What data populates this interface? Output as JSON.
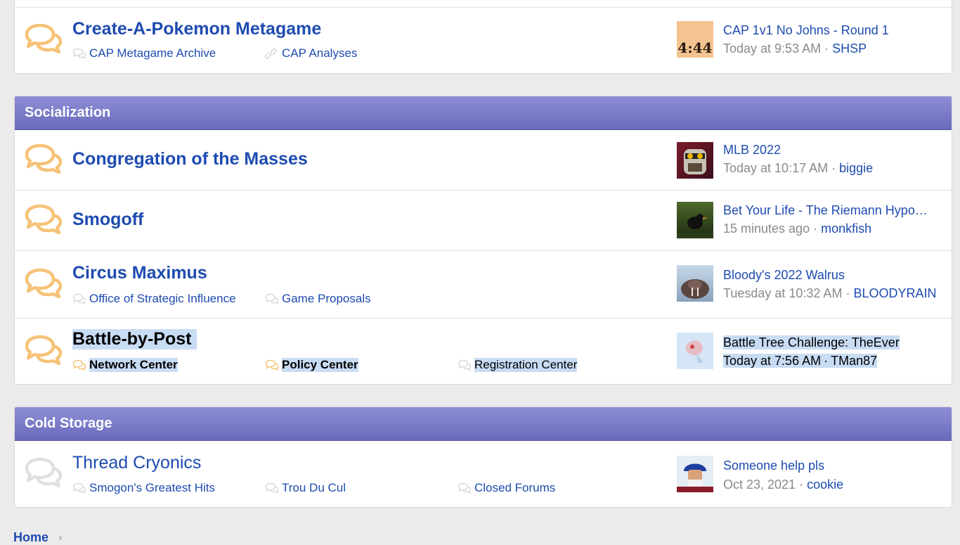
{
  "colors": {
    "link": "#1e4bb0",
    "icon_unread": "#f6c277",
    "icon_read": "#d8d8d8",
    "header_gradient_top": "#8e8ed6",
    "header_gradient_bottom": "#6a6abc",
    "selection": "#c8dcf4"
  },
  "cap": {
    "title": "Create-A-Pokemon Metagame",
    "subforums": [
      "CAP Metagame Archive",
      "CAP Analyses"
    ],
    "last_post": {
      "title": "CAP 1v1 No Johns - Round 1",
      "time": "Today at 9:53 AM",
      "user": "SHSP",
      "avatar_text": "4:44"
    }
  },
  "socialization": {
    "header": "Socialization",
    "forums": [
      {
        "title": "Congregation of the Masses",
        "last_post": {
          "title": "MLB 2022",
          "time": "Today at 10:17 AM",
          "user": "biggie"
        }
      },
      {
        "title": "Smogoff",
        "last_post": {
          "title": "Bet Your Life - The Riemann Hypo…",
          "time": "15 minutes ago",
          "user": "monkfish"
        }
      },
      {
        "title": "Circus Maximus",
        "subforums": [
          "Office of Strategic Influence",
          "Game Proposals"
        ],
        "last_post": {
          "title": "Bloody's 2022 Walrus",
          "time": "Tuesday at 10:32 AM",
          "user": "BLOODYRAIN"
        }
      },
      {
        "title": "Battle-by-Post",
        "subforums": [
          "Network Center",
          "Policy Center",
          "Registration Center"
        ],
        "last_post": {
          "title": "Battle Tree Challenge: TheEver",
          "time": "Today at 7:56 AM",
          "user": "TMan87"
        }
      }
    ]
  },
  "cold_storage": {
    "header": "Cold Storage",
    "forums": [
      {
        "title": "Thread Cryonics",
        "subforums": [
          "Smogon's Greatest Hits",
          "Trou Du Cul",
          "Closed Forums"
        ],
        "last_post": {
          "title": "Someone help pls",
          "time": "Oct 23, 2021",
          "user": "cookie"
        }
      }
    ]
  },
  "breadcrumb": {
    "home": "Home"
  },
  "separator": "·",
  "chevron": "›"
}
